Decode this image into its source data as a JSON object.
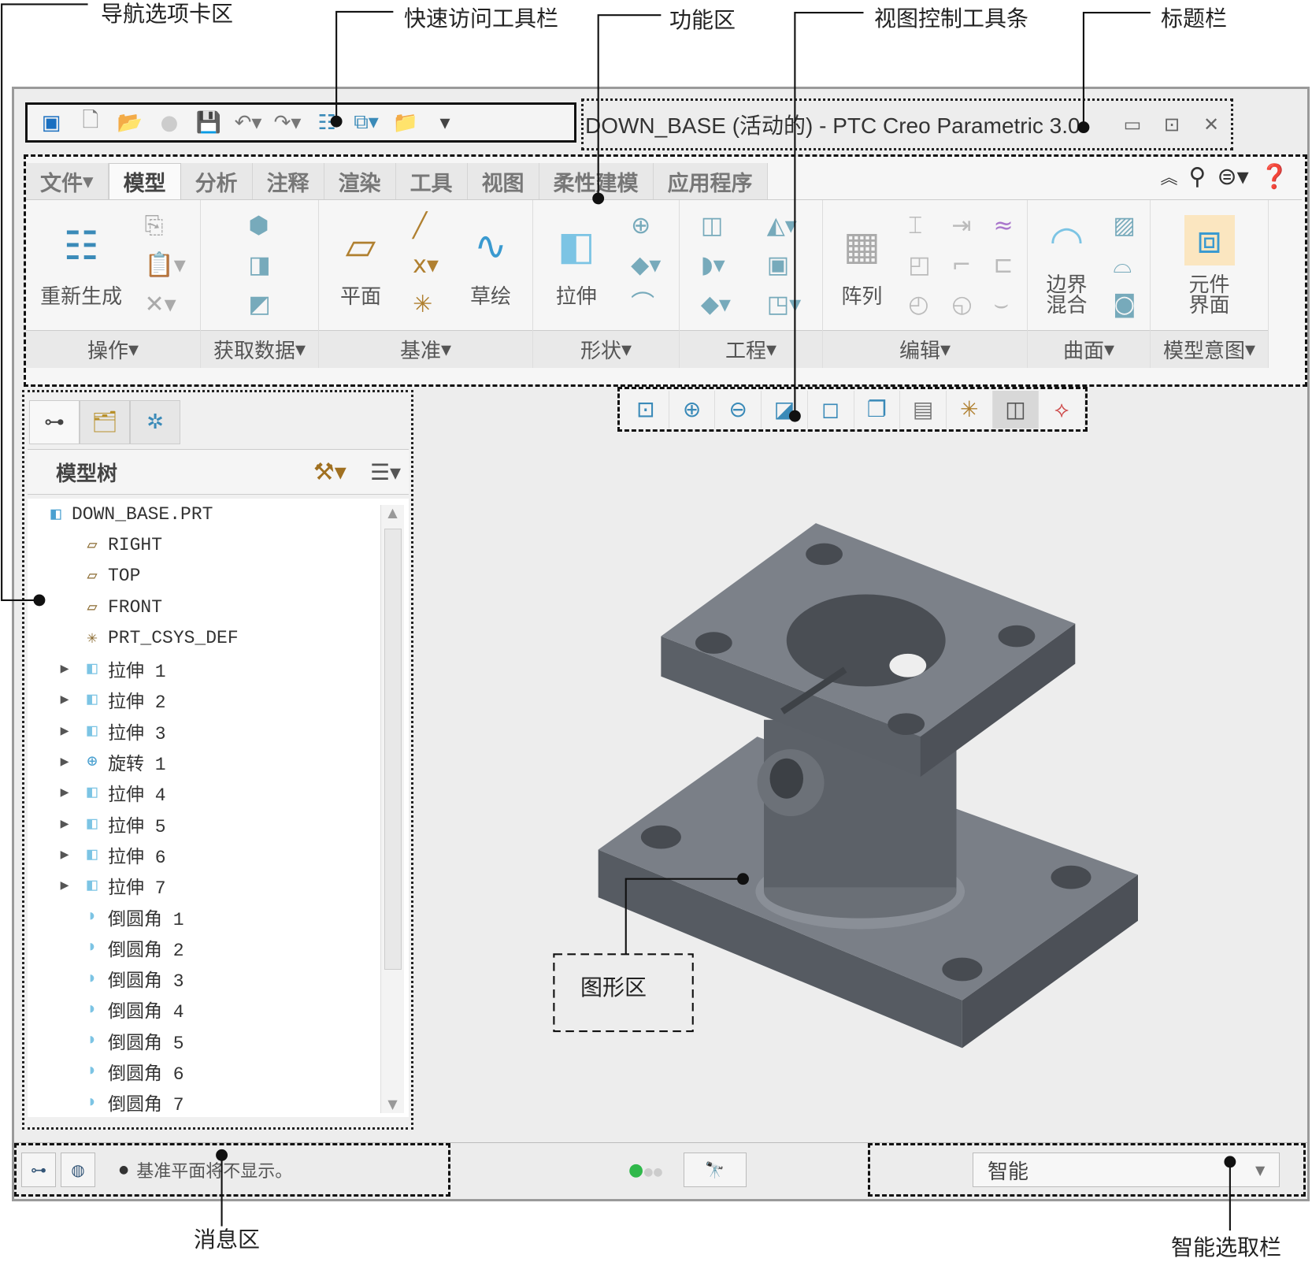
{
  "callouts": {
    "nav_tabs": "导航选项卡区",
    "quick_access": "快速访问工具栏",
    "ribbon": "功能区",
    "view_toolbar": "视图控制工具条",
    "title_bar": "标题栏",
    "graphics": "图形区",
    "message": "消息区",
    "smart_filter": "智能选取栏"
  },
  "title": "DOWN_BASE (活动的) - PTC Creo Parametric 3.0",
  "quick_access": [
    "window-icon",
    "new-icon",
    "open-icon",
    "sphere-icon",
    "save-icon",
    "undo-icon",
    "redo-icon",
    "regenerate-icon",
    "windows-icon",
    "close-window-icon",
    "customize-icon"
  ],
  "tabs": [
    "文件",
    "模型",
    "分析",
    "注释",
    "渲染",
    "工具",
    "视图",
    "柔性建模",
    "应用程序"
  ],
  "active_tab": "模型",
  "groups": {
    "operations": "操作",
    "get_data": "获取数据",
    "datum": "基准",
    "shapes": "形状",
    "engineering": "工程",
    "editing": "编辑",
    "surfaces": "曲面",
    "model_intent": "模型意图"
  },
  "buttons": {
    "regenerate": "重新生成",
    "plane": "平面",
    "sketch": "草绘",
    "extrude": "拉伸",
    "pattern": "阵列",
    "boundary_blend": "边界混合",
    "component_interface": "元件界面"
  },
  "view_toolbar": [
    "refit-icon",
    "zoom-in-icon",
    "zoom-out-icon",
    "repaint-icon",
    "display-style-icon",
    "saved-views-icon",
    "view-manager-icon",
    "datum-display-icon",
    "annotation-display-icon",
    "spin-center-icon"
  ],
  "nav": {
    "tree_title": "模型树",
    "tree": [
      {
        "label": "DOWN_BASE.PRT",
        "icon": "part",
        "expand": false,
        "indent": 0
      },
      {
        "label": "RIGHT",
        "icon": "plane",
        "expand": false,
        "indent": 1
      },
      {
        "label": "TOP",
        "icon": "plane",
        "expand": false,
        "indent": 1
      },
      {
        "label": "FRONT",
        "icon": "plane",
        "expand": false,
        "indent": 1
      },
      {
        "label": "PRT_CSYS_DEF",
        "icon": "csys",
        "expand": false,
        "indent": 1
      },
      {
        "label": "拉伸 1",
        "icon": "extrude",
        "expand": true,
        "indent": 1
      },
      {
        "label": "拉伸 2",
        "icon": "extrude",
        "expand": true,
        "indent": 1
      },
      {
        "label": "拉伸 3",
        "icon": "extrude",
        "expand": true,
        "indent": 1
      },
      {
        "label": "旋转 1",
        "icon": "revolve",
        "expand": true,
        "indent": 1
      },
      {
        "label": "拉伸 4",
        "icon": "extrude",
        "expand": true,
        "indent": 1
      },
      {
        "label": "拉伸 5",
        "icon": "extrude",
        "expand": true,
        "indent": 1
      },
      {
        "label": "拉伸 6",
        "icon": "extrude",
        "expand": true,
        "indent": 1
      },
      {
        "label": "拉伸 7",
        "icon": "extrude",
        "expand": true,
        "indent": 1
      },
      {
        "label": "倒圆角 1",
        "icon": "round",
        "expand": false,
        "indent": 1
      },
      {
        "label": "倒圆角 2",
        "icon": "round",
        "expand": false,
        "indent": 1
      },
      {
        "label": "倒圆角 3",
        "icon": "round",
        "expand": false,
        "indent": 1
      },
      {
        "label": "倒圆角 4",
        "icon": "round",
        "expand": false,
        "indent": 1
      },
      {
        "label": "倒圆角 5",
        "icon": "round",
        "expand": false,
        "indent": 1
      },
      {
        "label": "倒圆角 6",
        "icon": "round",
        "expand": false,
        "indent": 1
      },
      {
        "label": "倒圆角 7",
        "icon": "round",
        "expand": false,
        "indent": 1
      }
    ]
  },
  "status": {
    "message": "基准平面将不显示。",
    "smart_filter": "智能"
  },
  "colors": {
    "model": "#6e737b",
    "accent": "#3a8ab8",
    "status_green": "#2fb84a"
  }
}
